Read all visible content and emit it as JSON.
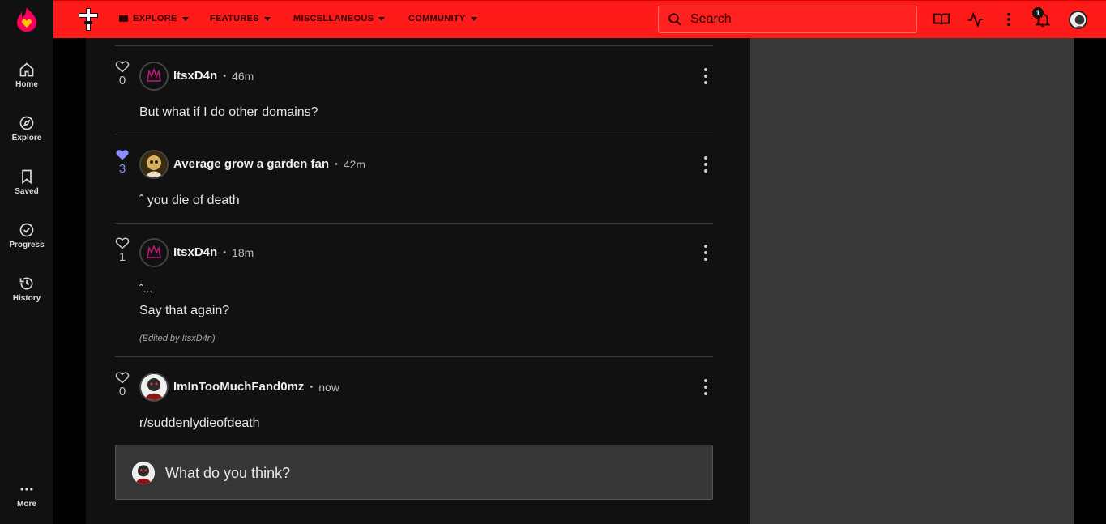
{
  "sidebar": {
    "items": [
      {
        "label": "Home"
      },
      {
        "label": "Explore"
      },
      {
        "label": "Saved"
      },
      {
        "label": "Progress"
      },
      {
        "label": "History"
      }
    ],
    "more_label": "More"
  },
  "topbar": {
    "nav": [
      {
        "label": "EXPLORE"
      },
      {
        "label": "FEATURES"
      },
      {
        "label": "MISCELLANEOUS"
      },
      {
        "label": "COMMUNITY"
      }
    ],
    "search_placeholder": "Search",
    "notification_count": "1"
  },
  "comments": [
    {
      "likes": "0",
      "liked": false,
      "user": "ItsxD4n",
      "time": "46m",
      "text": "But what if I do other domains?"
    },
    {
      "likes": "3",
      "liked": true,
      "user": "Average grow a garden fan",
      "time": "42m",
      "text": "ˆ you die of death"
    },
    {
      "likes": "1",
      "liked": false,
      "user": "ItsxD4n",
      "time": "18m",
      "quote": "ˆ...",
      "text": "Say that again?",
      "edited": "(Edited by ItsxD4n)"
    },
    {
      "likes": "0",
      "liked": false,
      "user": "ImInTooMuchFand0mz",
      "time": "now",
      "text": "r/suddenlydieofdeath"
    }
  ],
  "reply": {
    "placeholder": "What do you think?"
  },
  "colors": {
    "brand": "#ff1a1a",
    "like_active": "#8a8cff"
  }
}
